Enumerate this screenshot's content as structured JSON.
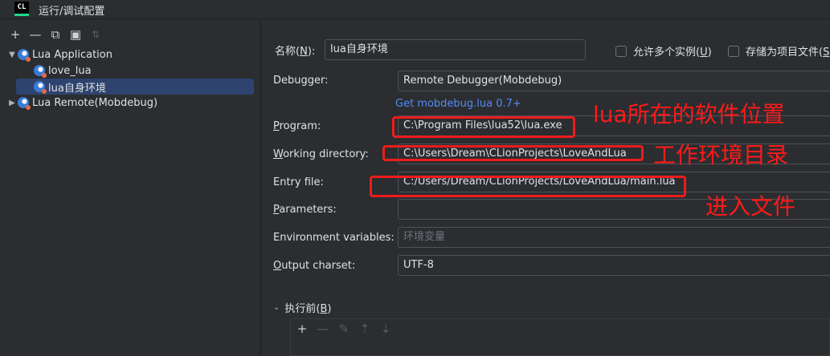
{
  "window": {
    "logo": "CL",
    "title": "运行/调试配置"
  },
  "toolbar": {
    "add": "+",
    "remove": "—",
    "copy": "⧉",
    "folder": "▣",
    "sort": "⇅"
  },
  "tree": {
    "lua_application": "Lua Application",
    "love_lua": "love_lua",
    "lua_self_env": "lua自身环境",
    "lua_remote": "Lua Remote(Mobdebug)"
  },
  "form": {
    "name_label_pre": "名称(",
    "name_label_key": "N",
    "name_label_post": "):",
    "name_value": "lua自身环境",
    "allow_multiple_pre": "允许多个实例(",
    "allow_multiple_key": "U",
    "allow_multiple_post": ")",
    "store_as_project_pre": "存储为项目文件(",
    "store_as_project_key": "S",
    "debugger_label": "Debugger:",
    "debugger_value": "Remote Debugger(Mobdebug)",
    "get_mobdebug_link": "Get mobdebug.lua 0.7+",
    "program_key": "P",
    "program_rest": "rogram:",
    "program_value": "C:\\Program Files\\lua52\\lua.exe",
    "workdir_key": "W",
    "workdir_rest": "orking directory:",
    "workdir_value": "C:\\Users\\Dream\\CLionProjects\\LoveAndLua",
    "entry_label": "Entry file:",
    "entry_value": "C:/Users/Dream/CLionProjects/LoveAndLua/main.lua",
    "params_key": "P",
    "params_rest": "arameters:",
    "params_value": "",
    "env_label": "Environment variables:",
    "env_placeholder": "环境变量",
    "charset_key": "O",
    "charset_rest": "utput charset:",
    "charset_value": "UTF-8",
    "before_launch_pre": "执行前(",
    "before_launch_key": "B",
    "before_launch_post": ")"
  },
  "before_toolbar": {
    "add": "+",
    "remove": "—",
    "edit": "✎",
    "up": "⇡",
    "down": "⇣"
  },
  "annotations": {
    "program_note": "lua所在的软件位置",
    "workdir_note": "工作环境目录",
    "entry_note": "进入文件"
  },
  "colors": {
    "accent_link": "#548af7",
    "selection": "#2e436e",
    "annotation_red": "#ee1c1c"
  }
}
